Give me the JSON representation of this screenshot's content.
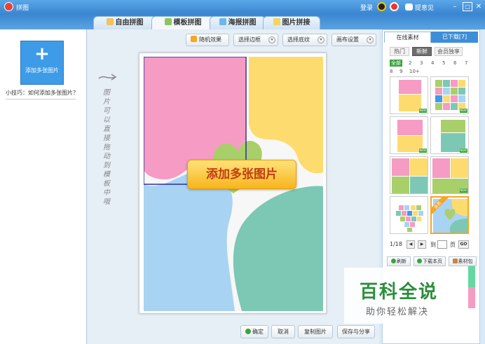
{
  "window": {
    "title": "拼图",
    "login": "登录",
    "feedback": "提意见"
  },
  "tabs": [
    {
      "label": "自由拼图",
      "active": false
    },
    {
      "label": "模板拼图",
      "active": true
    },
    {
      "label": "海报拼图",
      "active": false
    },
    {
      "label": "图片拼接",
      "active": false
    }
  ],
  "left_panel": {
    "add_button": "添加多张图片",
    "tip": "小技巧：如何添加多张图片？"
  },
  "toolbar": {
    "random": "随机效果",
    "border": "选择边框",
    "texture": "选择底纹",
    "canvas": "画布设置"
  },
  "canvas": {
    "handwriting": "图片可以直接拖动到模板中哦",
    "add_banner": "添加多张图片"
  },
  "bottom_bar": {
    "confirm": "确定",
    "cancel": "取消",
    "copy": "复制图片",
    "save": "保存与分享"
  },
  "right_panel": {
    "tab_online": "在线素材",
    "tab_downloaded": "已下载[7]",
    "subtabs": [
      "热门",
      "新鲜",
      "会员独享"
    ],
    "nums": [
      "全部",
      "2",
      "3",
      "4",
      "5",
      "6",
      "7",
      "8",
      "9",
      "10+"
    ],
    "new_badge": "NEW",
    "vip_badge": "会员",
    "page_info": "1/18",
    "page_to": "到",
    "page_unit": "页",
    "go": "GO",
    "refresh": "刷新",
    "download_page": "下载本页",
    "material_pack": "素材包"
  },
  "watermark": {
    "main": "百科全说",
    "sub": "助你轻松解决"
  },
  "colors": {
    "pink": "#f59bc4",
    "yellow": "#fddb6e",
    "green": "#a9cf6a",
    "blue": "#a9d3f2",
    "teal": "#7cc8b4",
    "accent": "#3d9be8"
  }
}
